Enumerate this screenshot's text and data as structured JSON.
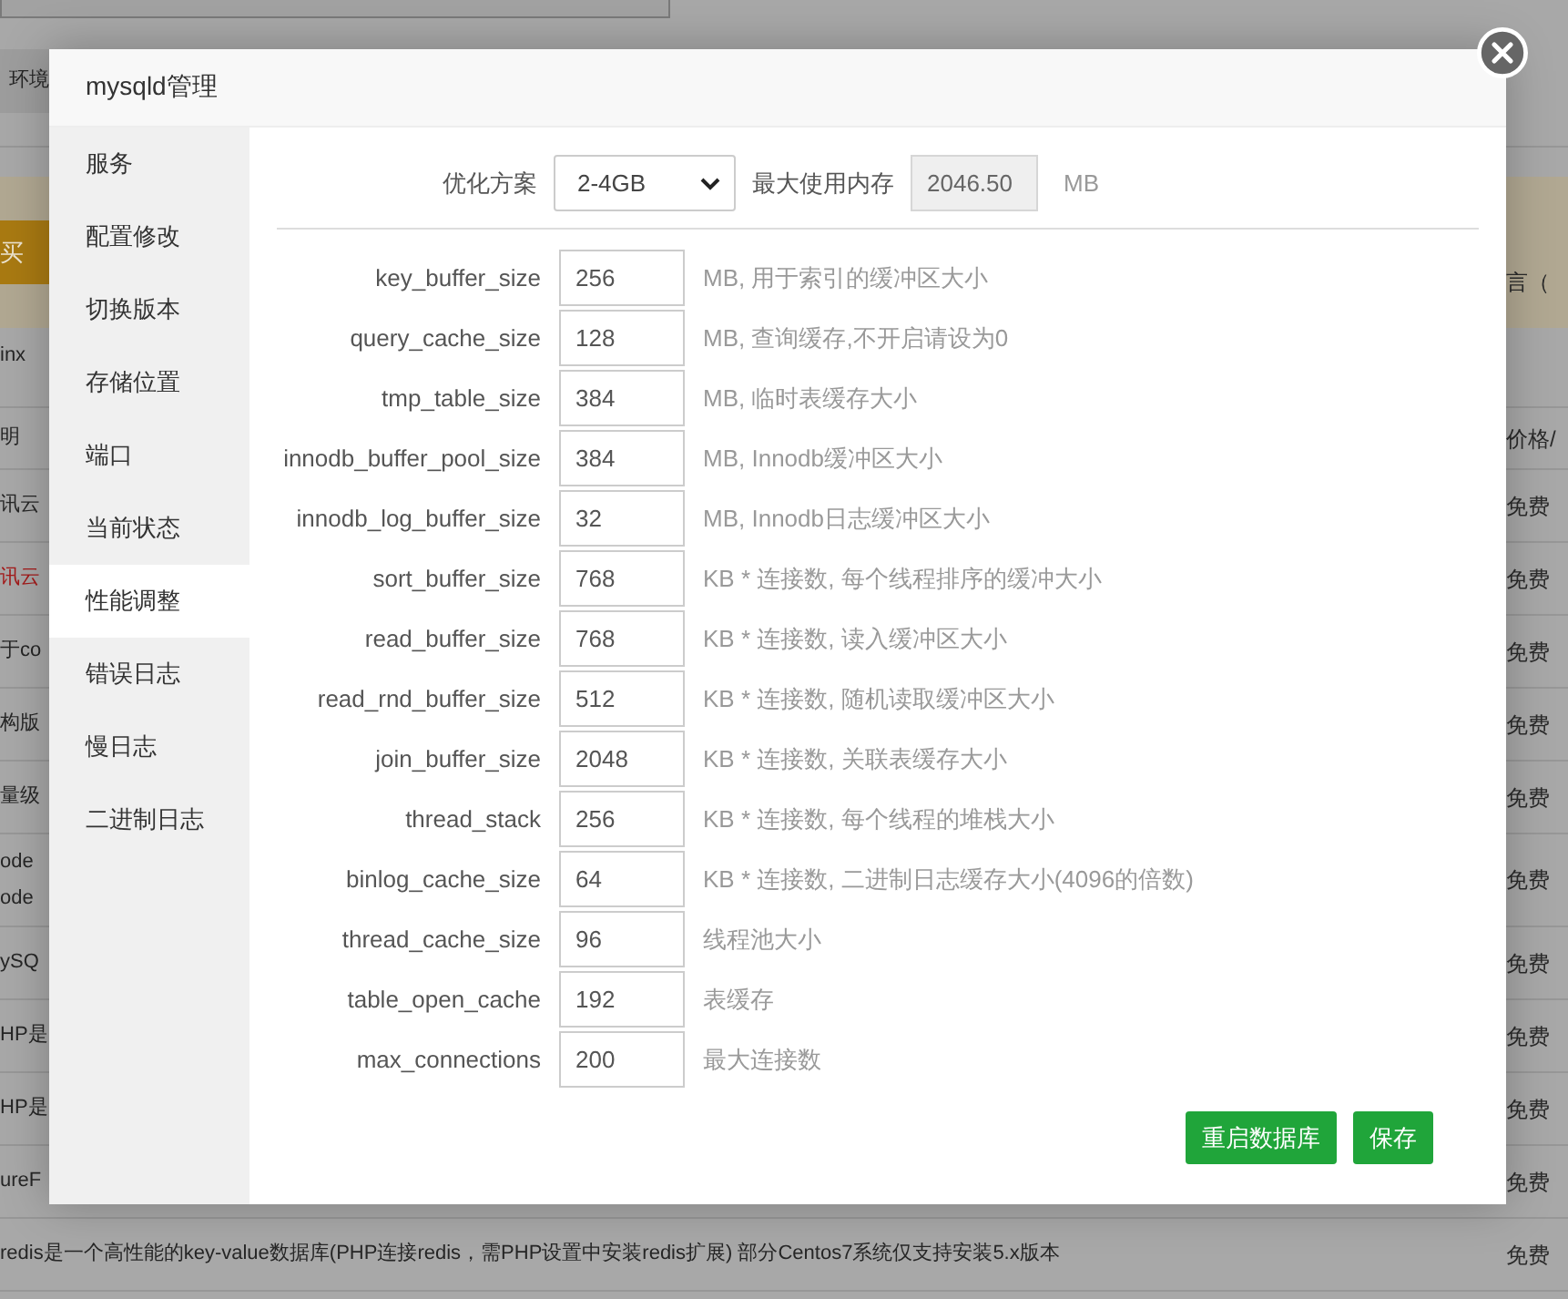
{
  "background_page": {
    "tab": "环境",
    "notice": {
      "button": "买",
      "text": "言（"
    },
    "intro": "inx",
    "table": {
      "header": {
        "column_1": "明",
        "column_3": "价格/"
      },
      "rows": [
        {
          "column_1": [
            "讯云"
          ],
          "column_3": "免费",
          "color": "#262626"
        },
        {
          "column_1": [
            "讯云"
          ],
          "column_3": "免费",
          "color": "#a31a1a"
        },
        {
          "column_1": [
            "于co"
          ],
          "column_3": "免费",
          "color": "#262626"
        },
        {
          "column_1": [
            "构版"
          ],
          "column_3": "免费",
          "color": "#262626"
        },
        {
          "column_1": [
            "量级"
          ],
          "column_3": "免费",
          "color": "#262626"
        },
        {
          "column_1": [
            "ode",
            "ode"
          ],
          "column_3": "免费",
          "color": "#262626"
        },
        {
          "column_1": [
            "ySQ"
          ],
          "column_3": "免费",
          "color": "#262626"
        },
        {
          "column_1": [
            "HP是"
          ],
          "column_3": "免费",
          "color": "#262626"
        },
        {
          "column_1": [
            "HP是"
          ],
          "column_3": "免费",
          "color": "#262626"
        },
        {
          "column_1": [
            "ureF"
          ],
          "column_3": "免费",
          "color": "#262626"
        },
        {
          "column_1": [
            "redis是一个高性能的key-value数据库(PHP连接redis，需PHP设置中安装redis扩展) 部分Centos7系统仅支持安装5.x版本"
          ],
          "column_3": "免费",
          "color": "#262626"
        }
      ]
    }
  },
  "modal": {
    "title": "mysqld管理",
    "sidebar": {
      "items": [
        {
          "label": "服务",
          "selected": false
        },
        {
          "label": "配置修改",
          "selected": false
        },
        {
          "label": "切换版本",
          "selected": false
        },
        {
          "label": "存储位置",
          "selected": false
        },
        {
          "label": "端口",
          "selected": false
        },
        {
          "label": "当前状态",
          "selected": false
        },
        {
          "label": "性能调整",
          "selected": true
        },
        {
          "label": "错误日志",
          "selected": false
        },
        {
          "label": "慢日志",
          "selected": false
        },
        {
          "label": "二进制日志",
          "selected": false
        }
      ]
    },
    "plan": {
      "label": "优化方案",
      "select": "2-4GB",
      "memory_label": "最大使用内存",
      "memory": {
        "value": "2046.50",
        "disabled": true
      },
      "unit": "MB"
    },
    "params": [
      {
        "name": "key_buffer_size",
        "value": "256",
        "hint": "MB, 用于索引的缓冲区大小"
      },
      {
        "name": "query_cache_size",
        "value": "128",
        "hint": "MB, 查询缓存,不开启请设为0"
      },
      {
        "name": "tmp_table_size",
        "value": "384",
        "hint": "MB, 临时表缓存大小"
      },
      {
        "name": "innodb_buffer_pool_size",
        "value": "384",
        "hint": "MB, Innodb缓冲区大小"
      },
      {
        "name": "innodb_log_buffer_size",
        "value": "32",
        "hint": "MB, Innodb日志缓冲区大小"
      },
      {
        "name": "sort_buffer_size",
        "value": "768",
        "hint": "KB * 连接数, 每个线程排序的缓冲大小"
      },
      {
        "name": "read_buffer_size",
        "value": "768",
        "hint": "KB * 连接数, 读入缓冲区大小"
      },
      {
        "name": "read_rnd_buffer_size",
        "value": "512",
        "hint": "KB * 连接数, 随机读取缓冲区大小"
      },
      {
        "name": "join_buffer_size",
        "value": "2048",
        "hint": "KB * 连接数, 关联表缓存大小"
      },
      {
        "name": "thread_stack",
        "value": "256",
        "hint": "KB * 连接数, 每个线程的堆栈大小"
      },
      {
        "name": "binlog_cache_size",
        "value": "64",
        "hint": "KB * 连接数, 二进制日志缓存大小(4096的倍数)"
      },
      {
        "name": "thread_cache_size",
        "value": "96",
        "hint": "线程池大小"
      },
      {
        "name": "table_open_cache",
        "value": "192",
        "hint": "表缓存"
      },
      {
        "name": "max_connections",
        "value": "200",
        "hint": "最大连接数"
      }
    ],
    "buttons": [
      "重启数据库",
      "保存"
    ]
  }
}
